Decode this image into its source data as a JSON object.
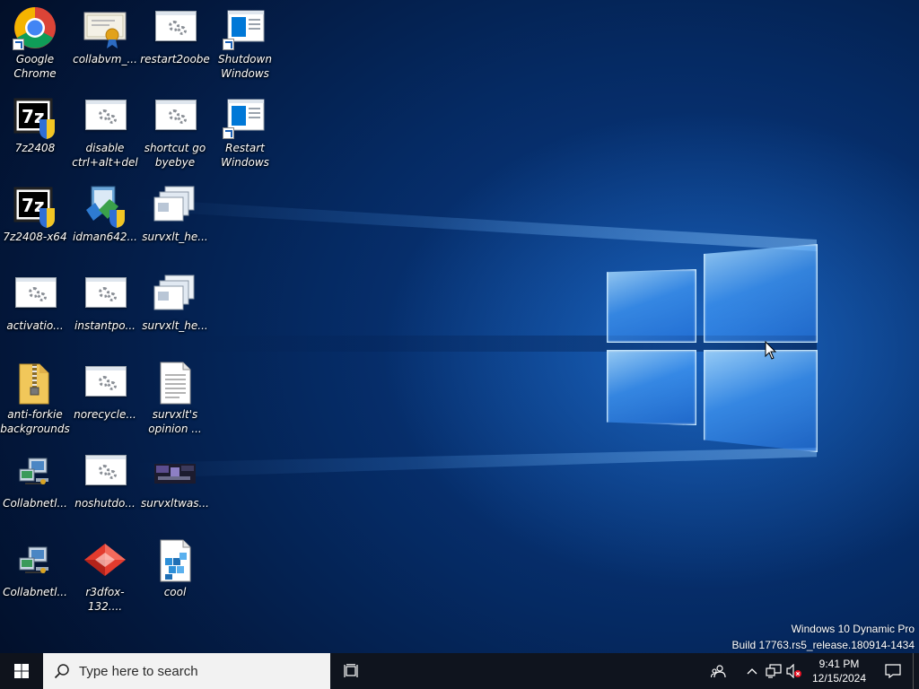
{
  "desktop": {
    "icons": [
      {
        "label": "Google Chrome"
      },
      {
        "label": "collabvm_..."
      },
      {
        "label": "restart2oobe"
      },
      {
        "label": "Shutdown Windows"
      },
      {
        "label": "7z2408"
      },
      {
        "label": "disable ctrl+alt+del"
      },
      {
        "label": "shortcut go byebye"
      },
      {
        "label": "Restart Windows"
      },
      {
        "label": "7z2408-x64"
      },
      {
        "label": "idman642..."
      },
      {
        "label": "survxlt_he..."
      },
      {
        "label": "activatio..."
      },
      {
        "label": "instantpo..."
      },
      {
        "label": "survxlt_he..."
      },
      {
        "label": "anti-forkie backgrounds"
      },
      {
        "label": "norecycle..."
      },
      {
        "label": "survxlt's opinion ..."
      },
      {
        "label": "Collabnetl..."
      },
      {
        "label": "noshutdo..."
      },
      {
        "label": "survxltwas..."
      },
      {
        "label": "Collabnetl..."
      },
      {
        "label": "r3dfox-132...."
      },
      {
        "label": "cool"
      }
    ]
  },
  "watermark": {
    "line1": "Windows 10 Dynamic Pro",
    "line2": "Build 17763.rs5_release.180914-1434"
  },
  "taskbar": {
    "search_placeholder": "Type here to search",
    "clock_time": "9:41 PM",
    "clock_date": "12/15/2024"
  },
  "colors": {
    "taskbar_bg": "#10141c",
    "searchbox_bg": "#f2f2f2",
    "accent": "#0078d7"
  }
}
